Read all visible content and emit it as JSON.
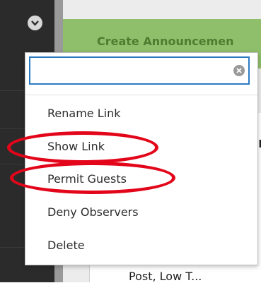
{
  "header": {
    "create_label": "Create Announcemen"
  },
  "search": {
    "value": "",
    "placeholder": ""
  },
  "menu": {
    "items": [
      {
        "label": "Rename Link"
      },
      {
        "label": "Show Link"
      },
      {
        "label": "Permit Guests"
      },
      {
        "label": "Deny Observers"
      },
      {
        "label": "Delete"
      }
    ]
  },
  "content": {
    "partial_heading": "r",
    "bottom_text": "Post, Low T..."
  },
  "colors": {
    "accent_blue": "#2a7bc4",
    "header_green": "#8fbf6a",
    "highlight_red": "#e3061a"
  },
  "icons": {
    "chevron": "chevron-down-icon",
    "clear": "clear-icon"
  }
}
